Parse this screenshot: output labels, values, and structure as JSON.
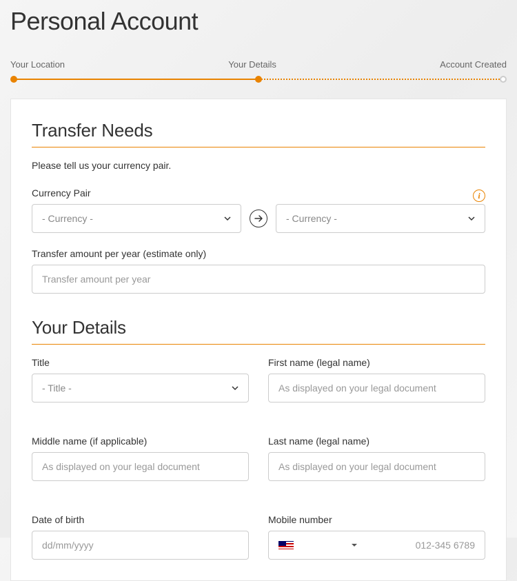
{
  "page": {
    "title": "Personal Account"
  },
  "stepper": {
    "step1": "Your Location",
    "step2": "Your Details",
    "step3": "Account Created"
  },
  "transfer": {
    "heading": "Transfer Needs",
    "subtext": "Please tell us your currency pair.",
    "currency_pair_label": "Currency Pair",
    "from_placeholder": "- Currency -",
    "to_placeholder": "- Currency -",
    "amount_label": "Transfer amount per year (estimate only)",
    "amount_placeholder": "Transfer amount per year"
  },
  "details": {
    "heading": "Your Details",
    "title_label": "Title",
    "title_placeholder": "- Title -",
    "first_name_label": "First name (legal name)",
    "first_name_placeholder": "As displayed on your legal document",
    "middle_name_label": "Middle name (if applicable)",
    "middle_name_placeholder": "As displayed on your legal document",
    "last_name_label": "Last name (legal name)",
    "last_name_placeholder": "As displayed on your legal document",
    "dob_label": "Date of birth",
    "dob_placeholder": "dd/mm/yyyy",
    "mobile_label": "Mobile number",
    "mobile_placeholder": "012-345 6789",
    "mobile_country": "MY"
  }
}
